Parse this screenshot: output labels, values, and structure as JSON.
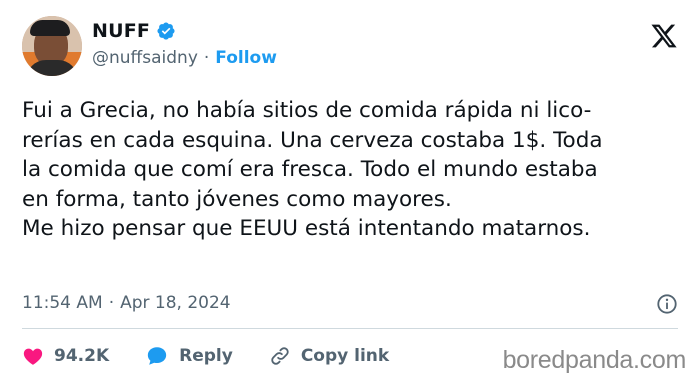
{
  "author": {
    "name": "NUFF",
    "handle": "@nuffsaidny",
    "separator": "·",
    "follow_label": "Follow",
    "verified_icon": "verified-badge-icon"
  },
  "tweet": {
    "text": "Fui a Grecia, no había sitios de comida rápida ni lico-\nrerías en cada esquina. Una cerveza costaba 1$. Toda\nla comida que comí era fresca. Todo el mundo estaba\nen forma, tanto jóvenes como mayores.\nMe hizo pensar que EEUU está intentando matarnos.",
    "time": "11:54 AM",
    "date_separator": "·",
    "date": "Apr 18, 2024"
  },
  "actions": {
    "likes": "94.2K",
    "reply_label": "Reply",
    "copy_label": "Copy link"
  },
  "watermark": "boredpanda.com",
  "colors": {
    "accent": "#1d9bf0",
    "like": "#f91880",
    "text": "#0f1419",
    "muted": "#536471"
  }
}
